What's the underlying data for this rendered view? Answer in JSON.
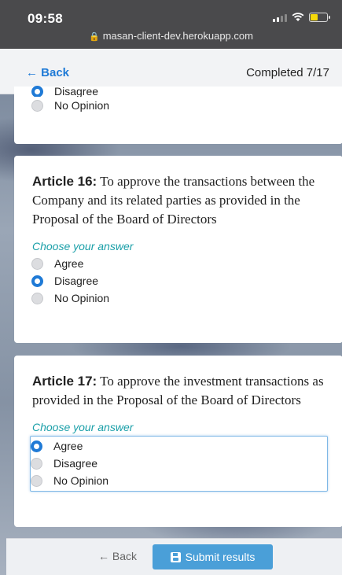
{
  "status_bar": {
    "time": "09:58",
    "url": "masan-client-dev.herokuapp.com",
    "battery_level": 0.45
  },
  "header": {
    "back_label": "← Back",
    "progress_label": "Completed 7/17"
  },
  "partial_card": {
    "options": [
      {
        "label": "Disagree",
        "selected": true
      },
      {
        "label": "No Opinion",
        "selected": false
      }
    ]
  },
  "articles": [
    {
      "title": "Article 16:",
      "text": " To approve the transactions between the Company and its related parties as provided in the Proposal of the Board of Directors",
      "prompt": "Choose your answer",
      "options": [
        {
          "label": "Agree",
          "selected": false
        },
        {
          "label": "Disagree",
          "selected": true
        },
        {
          "label": "No Opinion",
          "selected": false
        }
      ]
    },
    {
      "title": "Article 17:",
      "text": " To approve the investment transactions as provided in the Proposal of the Board of Directors",
      "prompt": "Choose your answer",
      "options": [
        {
          "label": "Agree",
          "selected": true
        },
        {
          "label": "Disagree",
          "selected": false
        },
        {
          "label": "No Opinion",
          "selected": false
        }
      ]
    }
  ],
  "footer": {
    "back_label": "← Back",
    "submit_label": "Submit results"
  },
  "colors": {
    "accent": "#1f7ad6",
    "submit": "#4a9fd8",
    "prompt": "#1a9fa8"
  }
}
